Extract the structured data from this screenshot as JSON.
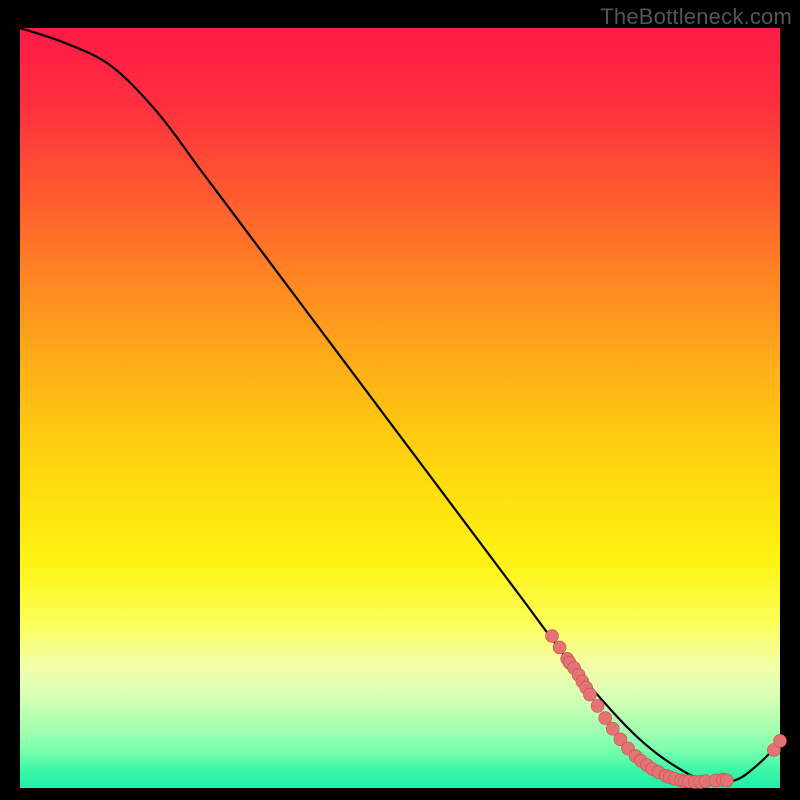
{
  "watermark": "TheBottleneck.com",
  "chart_data": {
    "type": "line",
    "title": "",
    "xlabel": "",
    "ylabel": "",
    "xlim": [
      0,
      100
    ],
    "ylim": [
      0,
      100
    ],
    "series": [
      {
        "name": "bottleneck-curve",
        "x": [
          0,
          6,
          12,
          18,
          24,
          30,
          36,
          42,
          48,
          54,
          60,
          66,
          72,
          78,
          82,
          86,
          90,
          94,
          97,
          100
        ],
        "y": [
          100,
          98,
          95,
          89,
          81,
          73,
          65,
          57,
          49,
          41,
          33,
          25,
          17,
          10,
          6,
          3,
          1,
          1,
          3,
          6
        ]
      }
    ],
    "scatter": {
      "name": "hardware-points",
      "points": [
        {
          "x": 70.0,
          "y": 20.0
        },
        {
          "x": 71.0,
          "y": 18.5
        },
        {
          "x": 72.0,
          "y": 17.0
        },
        {
          "x": 72.3,
          "y": 16.5
        },
        {
          "x": 72.9,
          "y": 15.8
        },
        {
          "x": 73.5,
          "y": 14.9
        },
        {
          "x": 74.0,
          "y": 14.0
        },
        {
          "x": 74.5,
          "y": 13.2
        },
        {
          "x": 75.0,
          "y": 12.3
        },
        {
          "x": 76.0,
          "y": 10.8
        },
        {
          "x": 77.0,
          "y": 9.2
        },
        {
          "x": 78.0,
          "y": 7.8
        },
        {
          "x": 79.0,
          "y": 6.4
        },
        {
          "x": 80.0,
          "y": 5.2
        },
        {
          "x": 81.0,
          "y": 4.2
        },
        {
          "x": 81.7,
          "y": 3.6
        },
        {
          "x": 82.5,
          "y": 3.0
        },
        {
          "x": 83.2,
          "y": 2.5
        },
        {
          "x": 84.0,
          "y": 2.1
        },
        {
          "x": 85.0,
          "y": 1.6
        },
        {
          "x": 85.5,
          "y": 1.4
        },
        {
          "x": 86.2,
          "y": 1.2
        },
        {
          "x": 87.0,
          "y": 1.0
        },
        {
          "x": 87.5,
          "y": 0.9
        },
        {
          "x": 88.0,
          "y": 0.9
        },
        {
          "x": 88.8,
          "y": 0.8
        },
        {
          "x": 89.5,
          "y": 0.8
        },
        {
          "x": 90.2,
          "y": 0.9
        },
        {
          "x": 91.5,
          "y": 1.0
        },
        {
          "x": 92.5,
          "y": 1.1
        },
        {
          "x": 93.0,
          "y": 1.0
        },
        {
          "x": 99.2,
          "y": 5.0
        },
        {
          "x": 100.0,
          "y": 6.2
        }
      ],
      "radius": 6.5
    }
  }
}
